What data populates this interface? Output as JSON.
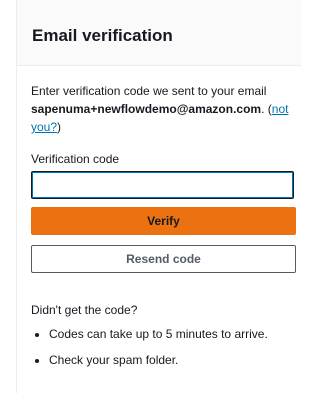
{
  "card": {
    "title": "Email verification"
  },
  "intro": {
    "text": "Enter verification code we sent to your email",
    "email": "sapenuma+newflowdemo@amazon.com",
    "after_email": ". (",
    "link": "not you?",
    "close": ")"
  },
  "form": {
    "code_label": "Verification code",
    "code_value": "",
    "code_placeholder": "",
    "verify_label": "Verify",
    "resend_label": "Resend code"
  },
  "help": {
    "title": "Didn't get the code?",
    "items": [
      "Codes can take up to 5 minutes to arrive.",
      "Check your spam folder."
    ]
  },
  "colors": {
    "primary_button": "#ec7211",
    "link": "#0073bb",
    "focus_ring": "#0073bb"
  }
}
